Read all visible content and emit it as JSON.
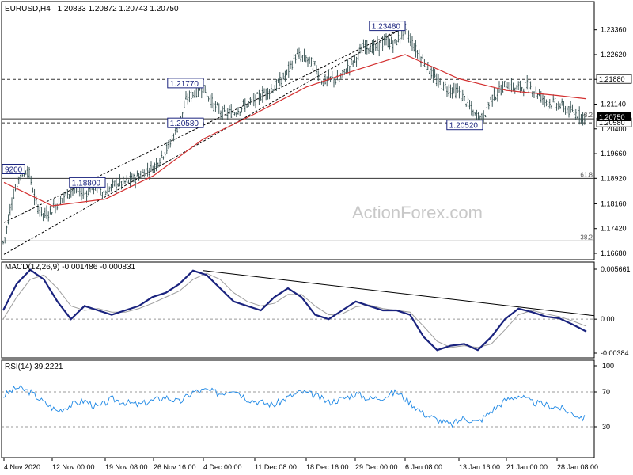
{
  "header": {
    "symbol": "EURUSD,H4",
    "ohlc": "1.20833 1.20872 1.20743 1.20750"
  },
  "watermark": "ActionForex.com",
  "chart_data": [
    {
      "type": "candlestick",
      "name": "EURUSD,H4",
      "y_axis_ticks": [
        "1.23360",
        "1.22620",
        "1.21880",
        "1.21140",
        "1.20400",
        "1.19660",
        "1.18920",
        "1.18160",
        "1.17420",
        "1.16680"
      ],
      "ylim": [
        1.1668,
        1.2366
      ],
      "x_tick_labels": [
        "4 Nov 2020",
        "12 Nov 00:00",
        "19 Nov 08:00",
        "26 Nov 16:00",
        "4 Dec 00:00",
        "11 Dec 08:00",
        "18 Dec 16:00",
        "29 Dec 00:00",
        "6 Jan 08:00",
        "13 Jan 16:00",
        "21 Jan 00:00",
        "28 Jan 08:00"
      ],
      "price_path": [
        [
          "4 Nov 2020",
          1.17
        ],
        [
          "5 Nov",
          1.183
        ],
        [
          "6 Nov",
          1.1905
        ],
        [
          "9 Nov",
          1.192
        ],
        [
          "10 Nov",
          1.1815
        ],
        [
          "11 Nov",
          1.178
        ],
        [
          "12 Nov 00:00",
          1.18
        ],
        [
          "13 Nov",
          1.1835
        ],
        [
          "16 Nov",
          1.186
        ],
        [
          "17 Nov",
          1.1845
        ],
        [
          "18 Nov",
          1.187
        ],
        [
          "19 Nov 08:00",
          1.185
        ],
        [
          "20 Nov",
          1.1875
        ],
        [
          "23 Nov",
          1.188
        ],
        [
          "24 Nov",
          1.189
        ],
        [
          "25 Nov",
          1.191
        ],
        [
          "26 Nov 16:00",
          1.1925
        ],
        [
          "27 Nov",
          1.196
        ],
        [
          "30 Nov",
          1.1995
        ],
        [
          "1 Dec",
          1.205
        ],
        [
          "2 Dec",
          1.213
        ],
        [
          "3 Dec",
          1.215
        ],
        [
          "4 Dec 00:00",
          1.2165
        ],
        [
          "7 Dec",
          1.211
        ],
        [
          "8 Dec",
          1.2085
        ],
        [
          "9 Dec",
          1.209
        ],
        [
          "10 Dec",
          1.211
        ],
        [
          "11 Dec 08:00",
          1.2125
        ],
        [
          "14 Dec",
          1.215
        ],
        [
          "15 Dec",
          1.2165
        ],
        [
          "16 Dec",
          1.22
        ],
        [
          "17 Dec",
          1.226
        ],
        [
          "18 Dec 16:00",
          1.225
        ],
        [
          "21 Dec",
          1.223
        ],
        [
          "22 Dec",
          1.218
        ],
        [
          "23 Dec",
          1.219
        ],
        [
          "24 Dec",
          1.2185
        ],
        [
          "28 Dec",
          1.222
        ],
        [
          "29 Dec 00:00",
          1.225
        ],
        [
          "30 Dec",
          1.229
        ],
        [
          "31 Dec",
          1.228
        ],
        [
          "4 Jan",
          1.23
        ],
        [
          "5 Jan",
          1.2295
        ],
        [
          "6 Jan 08:00",
          1.234
        ],
        [
          "7 Jan",
          1.2275
        ],
        [
          "8 Jan",
          1.223
        ],
        [
          "11 Jan",
          1.218
        ],
        [
          "12 Jan",
          1.216
        ],
        [
          "13 Jan 16:00",
          1.215
        ],
        [
          "14 Jan",
          1.212
        ],
        [
          "15 Jan",
          1.208
        ],
        [
          "18 Jan",
          1.207
        ],
        [
          "19 Jan",
          1.213
        ],
        [
          "20 Jan",
          1.215
        ],
        [
          "21 Jan 00:00",
          1.2175
        ],
        [
          "22 Jan",
          1.216
        ],
        [
          "25 Jan",
          1.217
        ],
        [
          "26 Jan",
          1.215
        ],
        [
          "27 Jan",
          1.212
        ],
        [
          "28 Jan 08:00",
          1.2115
        ],
        [
          "29 Jan",
          1.209
        ],
        [
          "end",
          1.2075
        ]
      ],
      "moving_average_path": [
        [
          "4 Nov 2020",
          1.188
        ],
        [
          "12 Nov 00:00",
          1.181
        ],
        [
          "19 Nov 08:00",
          1.183
        ],
        [
          "26 Nov 16:00",
          1.19
        ],
        [
          "4 Dec 00:00",
          1.201
        ],
        [
          "11 Dec 08:00",
          1.2085
        ],
        [
          "18 Dec 16:00",
          1.2165
        ],
        [
          "29 Dec 00:00",
          1.2215
        ],
        [
          "6 Jan 08:00",
          1.2262
        ],
        [
          "13 Jan 16:00",
          1.219
        ],
        [
          "21 Jan 00:00",
          1.2155
        ],
        [
          "28 Jan 08:00",
          1.214
        ],
        [
          "end",
          1.213
        ]
      ],
      "trendlines": [
        {
          "from": [
            "4 Nov 2020",
            1.176
          ],
          "to": [
            "6 Jan 08:00",
            1.2345
          ]
        },
        {
          "from": [
            "4 Nov 2020",
            1.1665
          ],
          "to": [
            "6 Jan 08:00",
            1.2345
          ]
        }
      ],
      "horizontal_levels": [
        {
          "price": 1.2188,
          "label": "1.21880",
          "style": "dashed",
          "highlighted": true
        },
        {
          "price": 1.207,
          "label": "",
          "style": "solid"
        },
        {
          "price": 1.2058,
          "label": "1.20580",
          "style": "dashed",
          "highlighted": true
        },
        {
          "price": 1.1892,
          "label": "61.8",
          "style": "solid"
        },
        {
          "price": 1.1705,
          "label": "38.2",
          "style": "solid"
        }
      ],
      "fib_label_near_price": "8.2",
      "current_price_label": "1.20750",
      "annotations": [
        {
          "text": "1.23480",
          "at": [
            "6 Jan 08:00",
            1.2348
          ]
        },
        {
          "text": "1.21770",
          "at": [
            "4 Dec 00:00",
            1.2177
          ]
        },
        {
          "text": "1.20580",
          "at": [
            "4 Dec 00:00",
            1.2058
          ]
        },
        {
          "text": "1.20520",
          "at": [
            "18 Jan",
            1.2052
          ]
        },
        {
          "text": "1.18800",
          "at": [
            "19 Nov 08:00",
            1.188
          ]
        },
        {
          "text": "9200",
          "at": [
            "4 Nov 2020",
            1.192
          ]
        }
      ]
    },
    {
      "type": "line",
      "name": "MACD(12,26,9)",
      "title": "MACD(12,26,9) -0.001486 -0.000831",
      "y_axis_ticks": [
        "0.005661",
        "0.00",
        "-0.00384"
      ],
      "ylim": [
        -0.00384,
        0.005661
      ],
      "series": [
        {
          "name": "MACD",
          "values": [
            0.001,
            0.004,
            0.0056,
            0.0045,
            0.002,
            0.0,
            0.0015,
            0.001,
            0.0005,
            0.001,
            0.0015,
            0.0025,
            0.003,
            0.004,
            0.0055,
            0.005,
            0.0035,
            0.002,
            0.0015,
            0.001,
            0.0025,
            0.0035,
            0.0025,
            0.0005,
            0.0,
            0.001,
            0.002,
            0.0015,
            0.001,
            0.001,
            0.0005,
            -0.002,
            -0.0035,
            -0.003,
            -0.0028,
            -0.0035,
            -0.002,
            0.0,
            0.0012,
            0.0008,
            0.0003,
            0.0001,
            -0.0006,
            -0.0014
          ]
        },
        {
          "name": "Signal",
          "values": [
            0.0,
            0.0025,
            0.0045,
            0.005,
            0.0035,
            0.0015,
            0.001,
            0.0012,
            0.0008,
            0.0008,
            0.0012,
            0.0018,
            0.0025,
            0.0032,
            0.0045,
            0.0052,
            0.0045,
            0.003,
            0.002,
            0.0015,
            0.0018,
            0.0028,
            0.0028,
            0.0015,
            0.0005,
            0.0006,
            0.0014,
            0.0016,
            0.0012,
            0.001,
            0.0008,
            -0.0008,
            -0.0025,
            -0.0032,
            -0.003,
            -0.0032,
            -0.0028,
            -0.0012,
            0.0005,
            0.001,
            0.0006,
            0.0003,
            -0.0002,
            -0.0008
          ]
        }
      ],
      "trendline": {
        "from": [
          "4 Dec 00:00",
          0.0055
        ],
        "to": [
          "end",
          0.0004
        ]
      }
    },
    {
      "type": "line",
      "name": "RSI(14)",
      "title": "RSI(14) 39.2221",
      "y_axis_ticks": [
        "100",
        "70",
        "30"
      ],
      "ylim": [
        0,
        100
      ],
      "levels": [
        70,
        30
      ],
      "series": [
        {
          "name": "RSI",
          "values": [
            65,
            75,
            70,
            58,
            48,
            55,
            60,
            52,
            62,
            58,
            55,
            60,
            64,
            58,
            70,
            72,
            68,
            74,
            62,
            58,
            55,
            64,
            70,
            66,
            58,
            62,
            68,
            62,
            64,
            70,
            58,
            45,
            38,
            32,
            40,
            35,
            48,
            60,
            66,
            58,
            55,
            52,
            45,
            39
          ]
        }
      ]
    }
  ]
}
